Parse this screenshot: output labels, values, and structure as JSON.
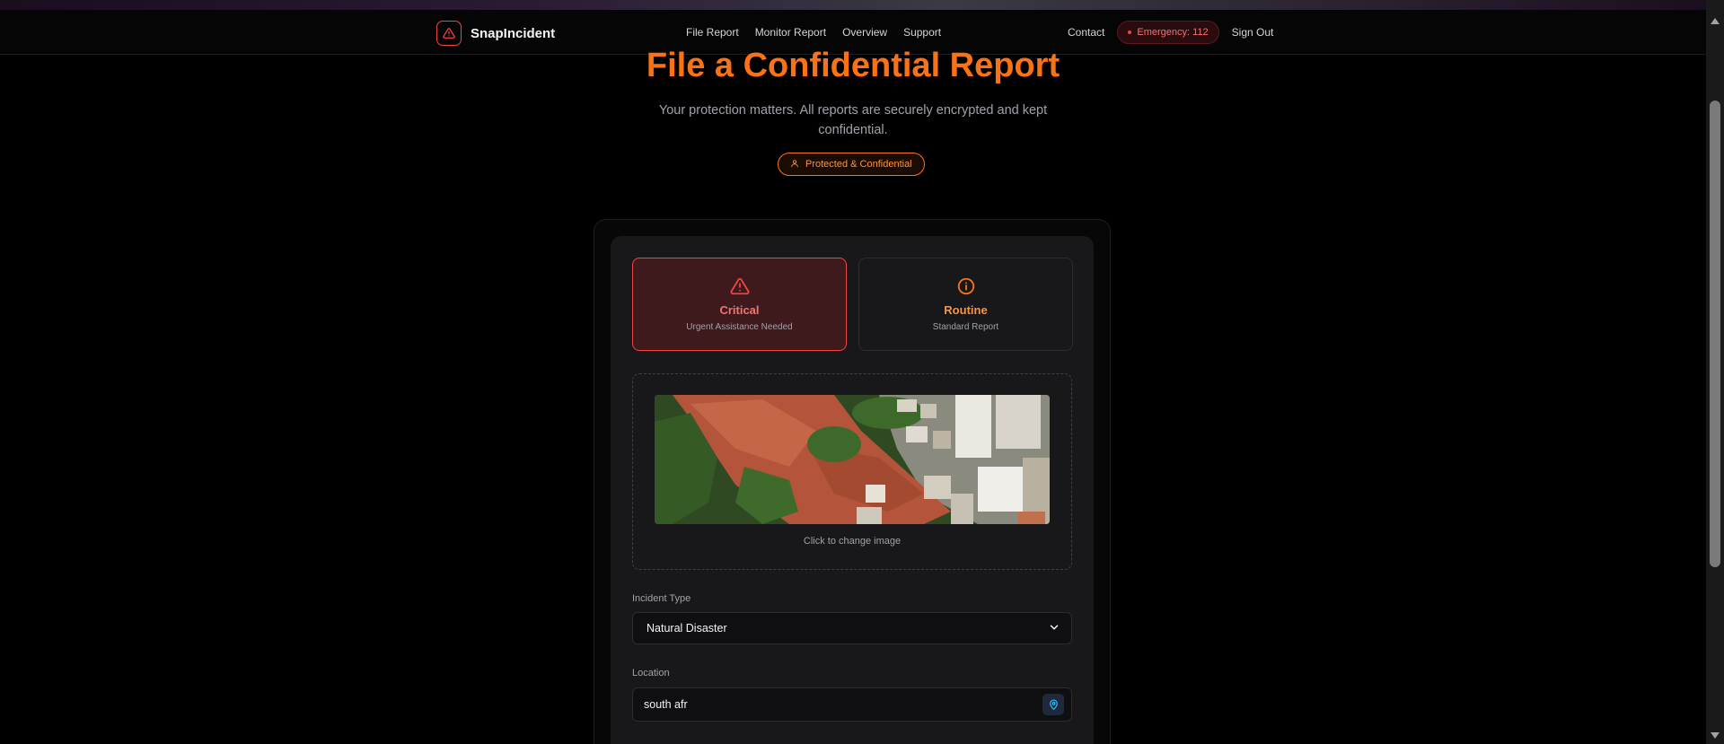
{
  "nav": {
    "brand": "SnapIncident",
    "links": [
      "File Report",
      "Monitor Report",
      "Overview",
      "Support"
    ],
    "contact": "Contact",
    "emergency": "Emergency: 112",
    "sign_out": "Sign Out"
  },
  "hero": {
    "title": "File a Confidential Report",
    "subtitle": "Your protection matters. All reports are securely encrypted and kept confidential.",
    "badge": "Protected & Confidential"
  },
  "priority": {
    "critical": {
      "title": "Critical",
      "subtitle": "Urgent Assistance Needed",
      "selected": true
    },
    "routine": {
      "title": "Routine",
      "subtitle": "Standard Report",
      "selected": false
    }
  },
  "upload": {
    "caption": "Click to change image",
    "image_icon": "landslide-photo"
  },
  "incident_type": {
    "label": "Incident Type",
    "value": "Natural Disaster"
  },
  "location": {
    "label": "Location",
    "value": "south afr"
  },
  "colors": {
    "accent": "#f97316",
    "danger": "#ef4444",
    "background": "#000000"
  }
}
